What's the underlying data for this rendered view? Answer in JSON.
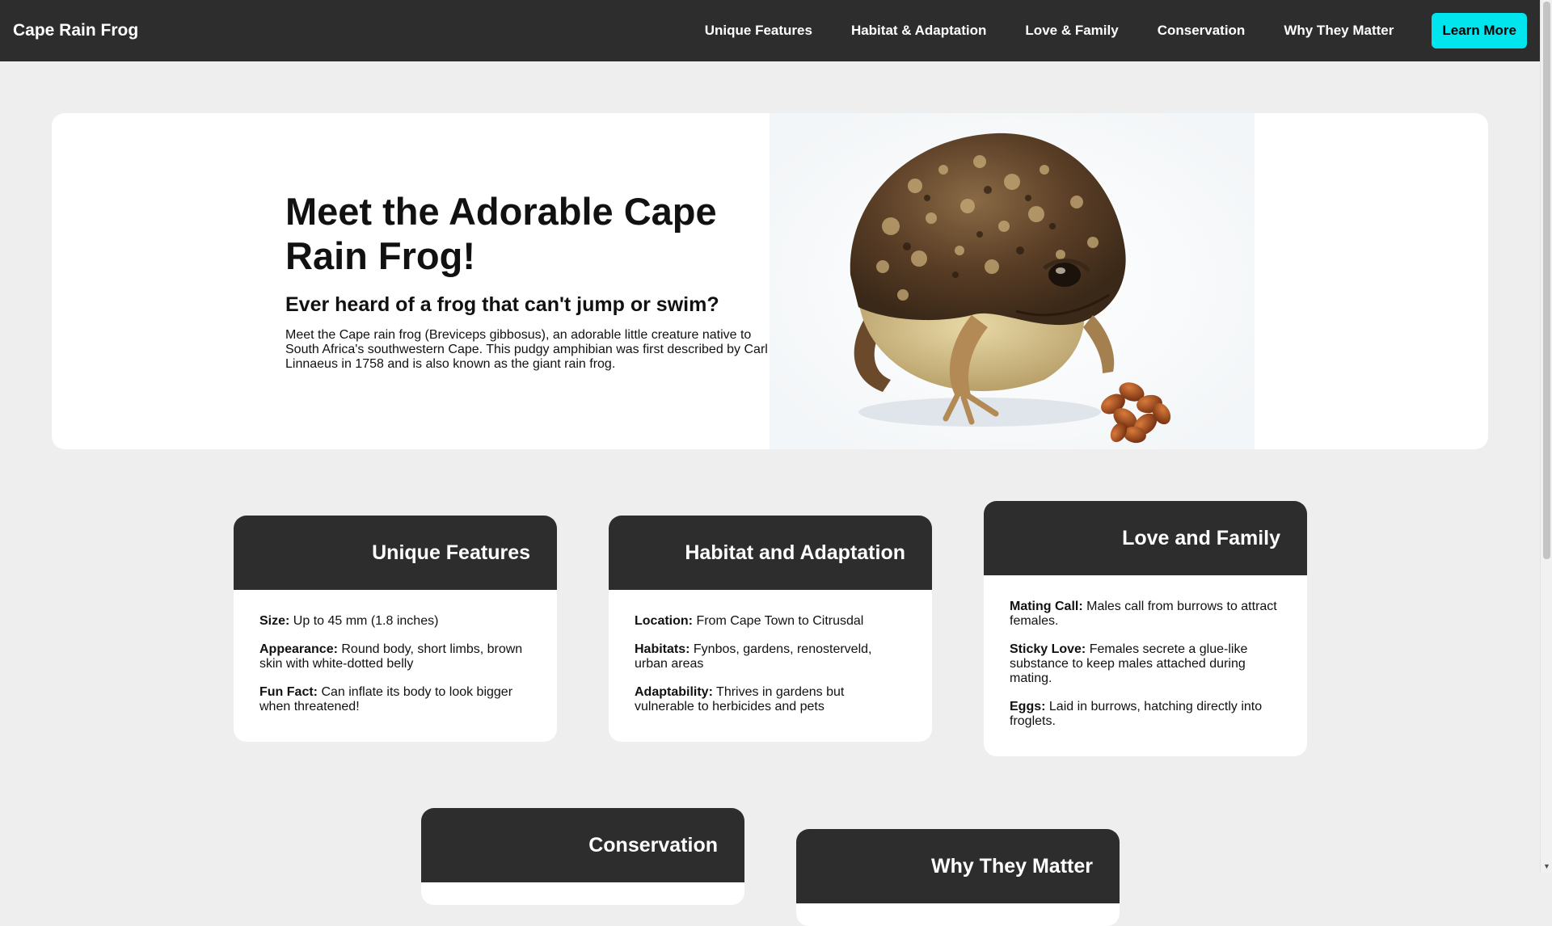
{
  "nav": {
    "brand": "Cape Rain Frog",
    "links": [
      {
        "label": "Unique Features"
      },
      {
        "label": "Habitat & Adaptation"
      },
      {
        "label": "Love & Family"
      },
      {
        "label": "Conservation"
      },
      {
        "label": "Why They Matter"
      }
    ],
    "cta_label": "Learn More",
    "cta_color": "#00e5ee"
  },
  "hero": {
    "title": "Meet the Adorable Cape Rain Frog!",
    "subtitle": "Ever heard of a frog that can't jump or swim?",
    "body": "Meet the Cape rain frog (Breviceps gibbosus), an adorable little creature native to South Africa's southwestern Cape. This pudgy amphibian was first described by Carl Linnaeus in 1758 and is also known as the giant rain frog.",
    "image": "cape-rain-frog-photo"
  },
  "cards": {
    "unique": {
      "title": "Unique Features",
      "facts": [
        {
          "label": "Size:",
          "text": " Up to 45 mm (1.8 inches)"
        },
        {
          "label": "Appearance:",
          "text": " Round body, short limbs, brown skin with white-dotted belly"
        },
        {
          "label": "Fun Fact:",
          "text": " Can inflate its body to look bigger when threatened!"
        }
      ]
    },
    "habitat": {
      "title": "Habitat and Adaptation",
      "facts": [
        {
          "label": "Location:",
          "text": " From Cape Town to Citrusdal"
        },
        {
          "label": "Habitats:",
          "text": " Fynbos, gardens, renosterveld, urban areas"
        },
        {
          "label": "Adaptability:",
          "text": " Thrives in gardens but vulnerable to herbicides and pets"
        }
      ]
    },
    "love": {
      "title": "Love and Family",
      "facts": [
        {
          "label": "Mating Call:",
          "text": " Males call from burrows to attract females."
        },
        {
          "label": "Sticky Love:",
          "text": " Females secrete a glue-like substance to keep males attached during mating."
        },
        {
          "label": "Eggs:",
          "text": " Laid in burrows, hatching directly into froglets."
        }
      ]
    },
    "conservation": {
      "title": "Conservation"
    },
    "why": {
      "title": "Why They Matter"
    }
  },
  "colors": {
    "page_bg": "#eeeeee",
    "nav_bg": "#2d2d2d",
    "card_head_bg": "#2d2d2d"
  }
}
